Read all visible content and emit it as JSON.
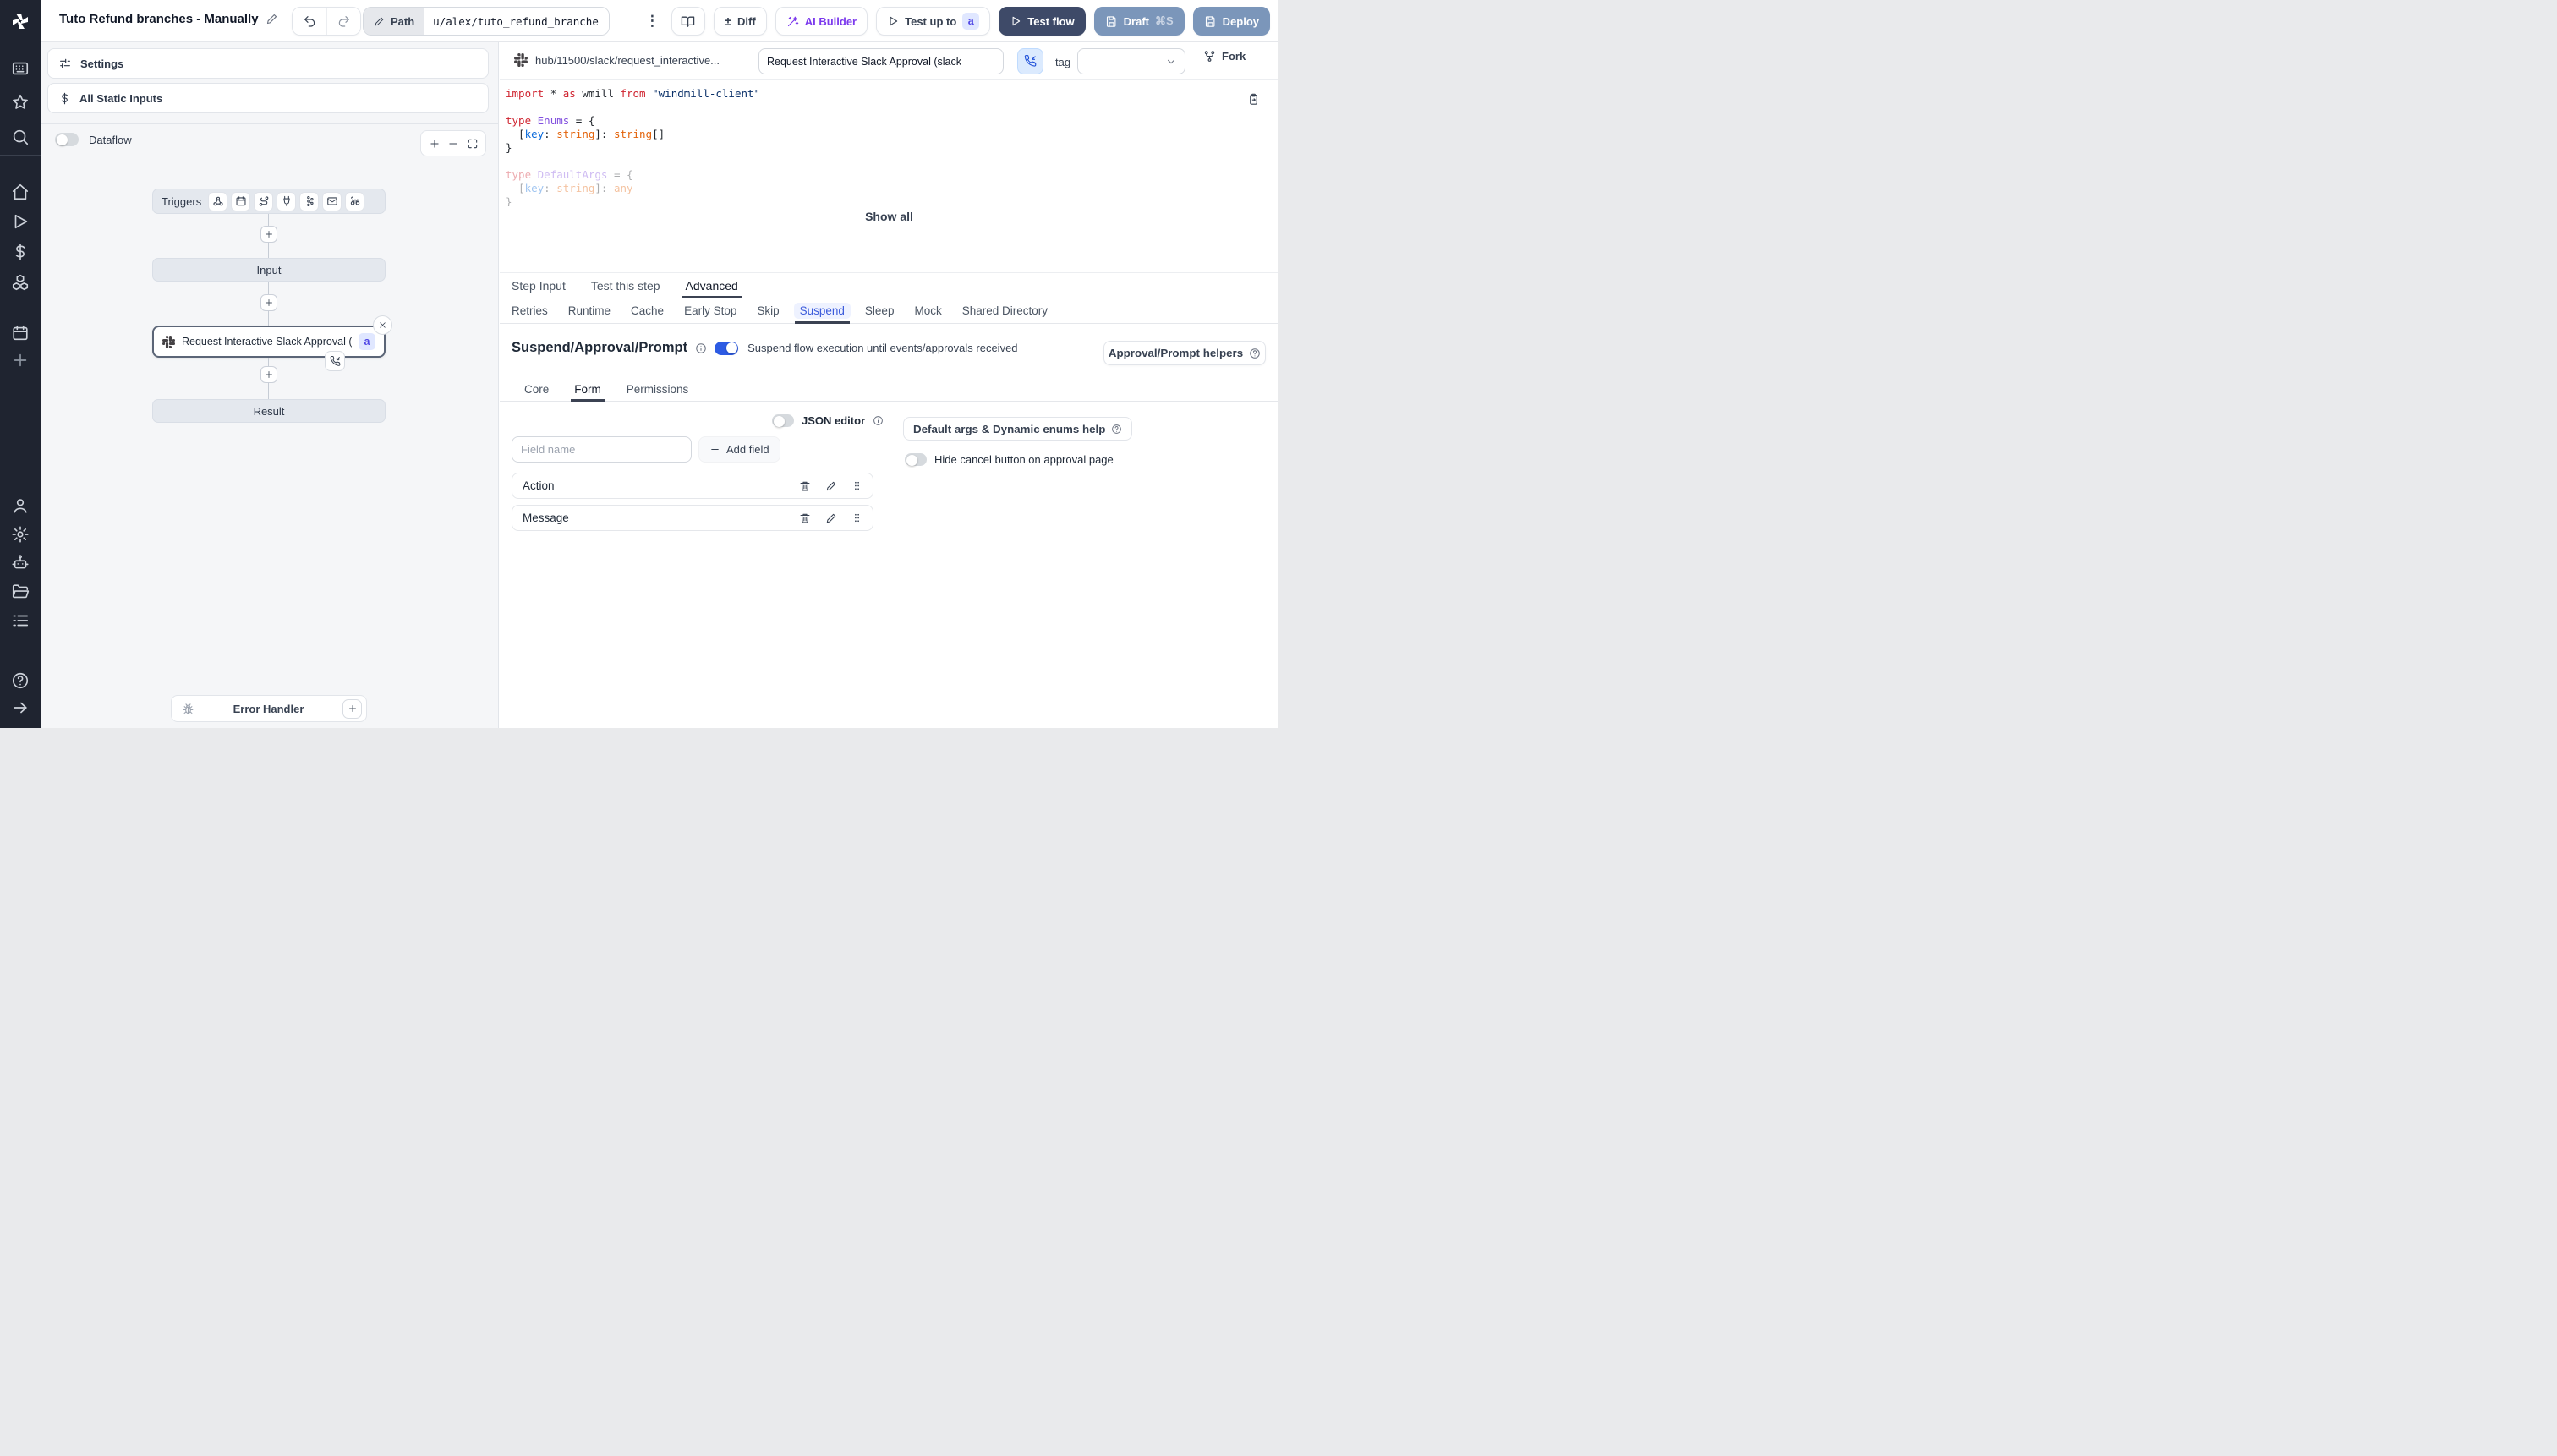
{
  "topbar": {
    "title": "Tuto Refund branches - Manually",
    "path_label": "Path",
    "path_value": "u/alex/tuto_refund_branches_",
    "more_glyph": "⋮",
    "diff_glyph": "±",
    "diff_label": "Diff",
    "ai_builder_label": "AI Builder",
    "test_up_to_label": "Test up to",
    "test_up_to_badge": "a",
    "test_flow_label": "Test flow",
    "draft_label": "Draft",
    "draft_shortcut": "⌘S",
    "deploy_label": "Deploy"
  },
  "left_panel": {
    "settings_label": "Settings",
    "static_inputs_label": "All Static Inputs",
    "dataflow_label": "Dataflow",
    "graph": {
      "triggers_label": "Triggers",
      "input_label": "Input",
      "step_title": "Request Interactive Slack Approval (...",
      "step_badge": "a",
      "result_label": "Result",
      "error_handler_label": "Error Handler"
    }
  },
  "right_panel": {
    "header": {
      "hub_path": "hub/11500/slack/request_interactive...",
      "script_title": "Request Interactive Slack Approval (slack",
      "tag_label": "tag",
      "fork_label": "Fork"
    },
    "show_all_label": "Show all",
    "tabs": [
      "Step Input",
      "Test this step",
      "Advanced"
    ],
    "subtabs": [
      "Retries",
      "Runtime",
      "Cache",
      "Early Stop",
      "Skip",
      "Suspend",
      "Sleep",
      "Mock",
      "Shared Directory"
    ],
    "suspend": {
      "heading": "Suspend/Approval/Prompt",
      "toggle_label": "Suspend flow execution until events/approvals received",
      "helpers_button": "Approval/Prompt helpers",
      "inner_tabs": [
        "Core",
        "Form",
        "Permissions"
      ],
      "form": {
        "json_editor_label": "JSON editor",
        "field_name_placeholder": "Field name",
        "add_field_label": "Add field",
        "default_args_button": "Default args & Dynamic enums help",
        "hide_cancel_label": "Hide cancel button on approval page",
        "fields": [
          "Action",
          "Message"
        ]
      }
    }
  },
  "code": {
    "lines": [
      {
        "tokens": [
          [
            "k",
            "import "
          ],
          [
            "d",
            "* "
          ],
          [
            "k",
            "as "
          ],
          [
            "d",
            "wmill "
          ],
          [
            "k",
            "from "
          ],
          [
            "s",
            "\"windmill-client\""
          ]
        ]
      },
      {
        "tokens": []
      },
      {
        "tokens": [
          [
            "k",
            "type "
          ],
          [
            "t",
            "Enums "
          ],
          [
            "d",
            "= {"
          ]
        ]
      },
      {
        "tokens": [
          [
            "d",
            "  ["
          ],
          [
            "b",
            "key"
          ],
          [
            "d",
            ": "
          ],
          [
            "o",
            "string"
          ],
          [
            "d",
            "]: "
          ],
          [
            "o",
            "string"
          ],
          [
            "d",
            "[]"
          ]
        ]
      },
      {
        "tokens": [
          [
            "d",
            "}"
          ]
        ]
      },
      {
        "tokens": []
      },
      {
        "tokens": [
          [
            "k",
            "type "
          ],
          [
            "t",
            "DefaultArgs "
          ],
          [
            "d",
            "= {"
          ]
        ],
        "faded": true
      },
      {
        "tokens": [
          [
            "d",
            "  ["
          ],
          [
            "b",
            "key"
          ],
          [
            "d",
            ": "
          ],
          [
            "o",
            "string"
          ],
          [
            "d",
            "]: "
          ],
          [
            "o",
            "any"
          ]
        ],
        "faded": true
      },
      {
        "tokens": [
          [
            "d",
            "}"
          ]
        ],
        "faded": true
      }
    ]
  },
  "colors": {
    "sidebar_bg": "#1f2430",
    "accent_blue": "#2d5be3",
    "dark_button_bg": "#3e4a68",
    "slate_button_bg": "#7b96ba",
    "ai_purple": "#7c3aed",
    "badge_bg": "#e0e7ff",
    "badge_text": "#4f46e5",
    "active_tab_underline": "#3b4252",
    "suspend_tab_text": "#3b5bdb",
    "suspend_tab_bg": "#eef2ff",
    "suspend_button_bg": "#dbeafe"
  }
}
